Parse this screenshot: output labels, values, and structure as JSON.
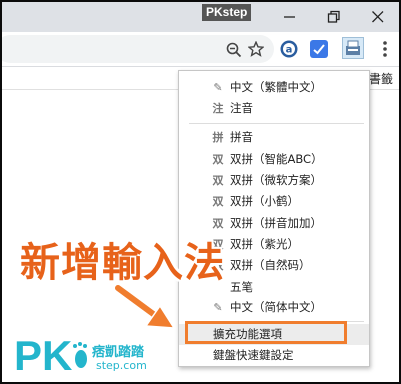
{
  "watermark": "PKstep",
  "window_controls": {
    "minimize": "minimize",
    "restore": "restore",
    "close": "close"
  },
  "toolbar": {
    "icons": [
      "zoom-icon",
      "star-icon",
      "extension-a-icon",
      "extension-check-icon",
      "ime-extension-icon",
      "menu-dots-icon"
    ]
  },
  "bookmarks": {
    "partial_label": "書籤"
  },
  "popup": {
    "items": [
      {
        "icon": "✎",
        "label": "中文（繁體中文）"
      },
      {
        "icon": "注",
        "label": "注音"
      },
      {
        "icon": "拼",
        "label": "拼音"
      },
      {
        "icon": "双",
        "label": "双拼（智能ABC）"
      },
      {
        "icon": "双",
        "label": "双拼（微软方案）"
      },
      {
        "icon": "双",
        "label": "双拼（小鹤）"
      },
      {
        "icon": "双",
        "label": "双拼（拼音加加）"
      },
      {
        "icon": "双",
        "label": "双拼（紫光）"
      },
      {
        "icon": "双",
        "label": "双拼（自然码）"
      },
      {
        "icon": "",
        "label": "五笔"
      },
      {
        "icon": "✎",
        "label": "中文（简体中文）"
      },
      {
        "icon": "",
        "label": "擴充功能選項"
      },
      {
        "icon": "",
        "label": "鍵盤快速鍵設定"
      }
    ]
  },
  "annotation": {
    "text": "新增輸入法"
  },
  "colors": {
    "accent": "#f07d2e",
    "logo": "#23b5cc",
    "titlebar": "#dee1e6"
  },
  "logo": {
    "brand": "PK",
    "chinese": "痞凱踏踏",
    "url": "step.com"
  }
}
